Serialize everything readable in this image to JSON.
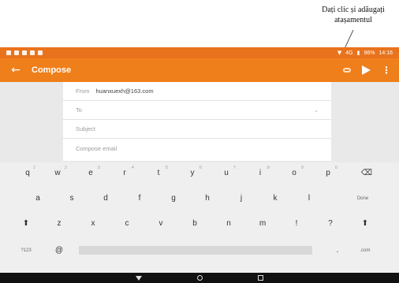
{
  "annotation": {
    "line1": "Dați clic și adăugați",
    "line2": "atașamentul"
  },
  "status_bar": {
    "network": "4G",
    "battery": "96%",
    "time": "14:16"
  },
  "app_bar": {
    "back_icon": "arrow-left-icon",
    "title": "Compose",
    "attach_icon": "paperclip-icon",
    "send_icon": "send-icon",
    "more_icon": "more-vert-icon"
  },
  "compose": {
    "from_label": "From",
    "from_value": "huanxuexh@163.com",
    "to_placeholder": "To",
    "subject_placeholder": "Subject",
    "body_placeholder": "Compose email"
  },
  "keyboard": {
    "row1": [
      "q",
      "w",
      "e",
      "r",
      "t",
      "y",
      "u",
      "i",
      "o",
      "p"
    ],
    "row1_hints": [
      "1",
      "2",
      "3",
      "4",
      "5",
      "6",
      "7",
      "8",
      "9",
      "0"
    ],
    "row2": [
      "a",
      "s",
      "d",
      "f",
      "g",
      "h",
      "j",
      "k",
      "l"
    ],
    "row3": [
      "z",
      "x",
      "c",
      "v",
      "b",
      "n",
      "m",
      "!",
      "?"
    ],
    "backspace_icon": "backspace-icon",
    "done_label": "Done",
    "shift_icon": "shift-icon",
    "symbols_label": "?123",
    "at_label": "@",
    "period_label": ".",
    "com_label": ".com"
  },
  "nav_bar": {
    "back_icon": "nav-back-icon",
    "home_icon": "nav-home-icon",
    "recents_icon": "nav-recents-icon"
  }
}
